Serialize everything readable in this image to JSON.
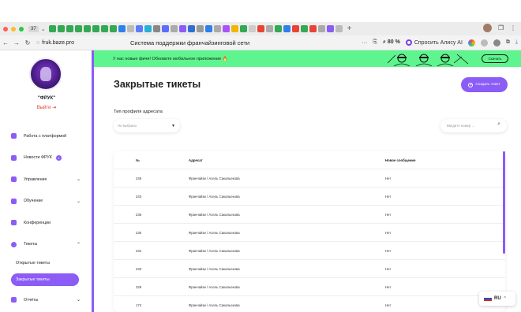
{
  "browser": {
    "tab_count": "37",
    "url": "fruk.baze.pro",
    "page_title": "Система поддержки франчайзинговой сети",
    "zoom": "80 %",
    "alice_label": "Спросить Алису AI"
  },
  "sidebar": {
    "user_name": "\"ФРУК\"",
    "logout_label": "Выйти",
    "menu": [
      {
        "label": "Работа с платформой",
        "icon": "platform-icon"
      },
      {
        "label": "Новости ФРУК",
        "icon": "megaphone-icon",
        "badge": "1"
      },
      {
        "label": "Управление",
        "icon": "gear-icon",
        "chevron": "⌄"
      },
      {
        "label": "Обучение",
        "icon": "book-icon",
        "chevron": "⌄"
      },
      {
        "label": "Конференции",
        "icon": "conference-icon"
      },
      {
        "label": "Тикеты",
        "icon": "ticket-icon",
        "chevron": "⌃"
      }
    ],
    "submenu": [
      {
        "label": "Открытые тикеты"
      },
      {
        "label": "Закрытые тикеты"
      }
    ],
    "reports": {
      "label": "Отчёты",
      "icon": "report-icon",
      "chevron": "⌄"
    }
  },
  "banner": {
    "text": "У нас новые фичи! Обновите мобильное приложение 🔥",
    "button": "Скачать",
    "color": "#5ef58e"
  },
  "main": {
    "title": "Закрытые тикеты",
    "create_button": "Создать тикет",
    "filter_label": "Тип профиля адресата",
    "select_value": "Не выбрано",
    "search_placeholder": "Введите номер ..."
  },
  "table": {
    "headers": {
      "num": "№",
      "addressee": "Адресат",
      "new_msg": "Новое сообщение"
    },
    "rows": [
      {
        "num": "245",
        "addressee": "Франчайзи / Асель Сакальекова",
        "new_msg": "Нет"
      },
      {
        "num": "243",
        "addressee": "Франчайзи / Асель Сакальекова",
        "new_msg": "Нет"
      },
      {
        "num": "236",
        "addressee": "Франчайзи / Асель Сакальекова",
        "new_msg": "Нет"
      },
      {
        "num": "230",
        "addressee": "Франчайзи / Асель Сакальекова",
        "new_msg": "Нет"
      },
      {
        "num": "234",
        "addressee": "Франчайзи / Асель Сакальекова",
        "new_msg": "Нет"
      },
      {
        "num": "233",
        "addressee": "Франчайзи / Асель Сакальекова",
        "new_msg": "Нет"
      },
      {
        "num": "229",
        "addressee": "Франчайзи / Асель Сакальекова",
        "new_msg": "Нет"
      },
      {
        "num": "174",
        "addressee": "Франчайзи / Асель Сакальекова",
        "new_msg": "Нет"
      }
    ]
  },
  "language": {
    "code": "RU"
  },
  "colors": {
    "accent": "#8b5cf6",
    "danger": "#e53935"
  }
}
